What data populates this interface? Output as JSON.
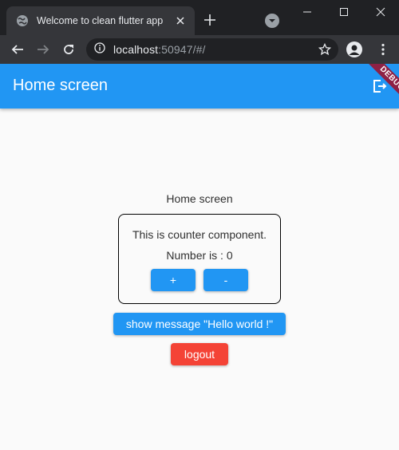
{
  "browser": {
    "tab_title": "Welcome to clean flutter app",
    "url_host": "localhost",
    "url_rest": ":50947/#/"
  },
  "app": {
    "appbar_title": "Home screen",
    "debug_banner": "DEBUG",
    "screen_label": "Home screen",
    "counter": {
      "description": "This is counter component.",
      "number_text": "Number is : 0",
      "increment_label": "+",
      "decrement_label": "-"
    },
    "show_message_label": "show message \"Hello world !\"",
    "logout_label": "logout"
  },
  "colors": {
    "primary": "#2196f3",
    "danger": "#f44336",
    "debug": "#8e2145"
  }
}
